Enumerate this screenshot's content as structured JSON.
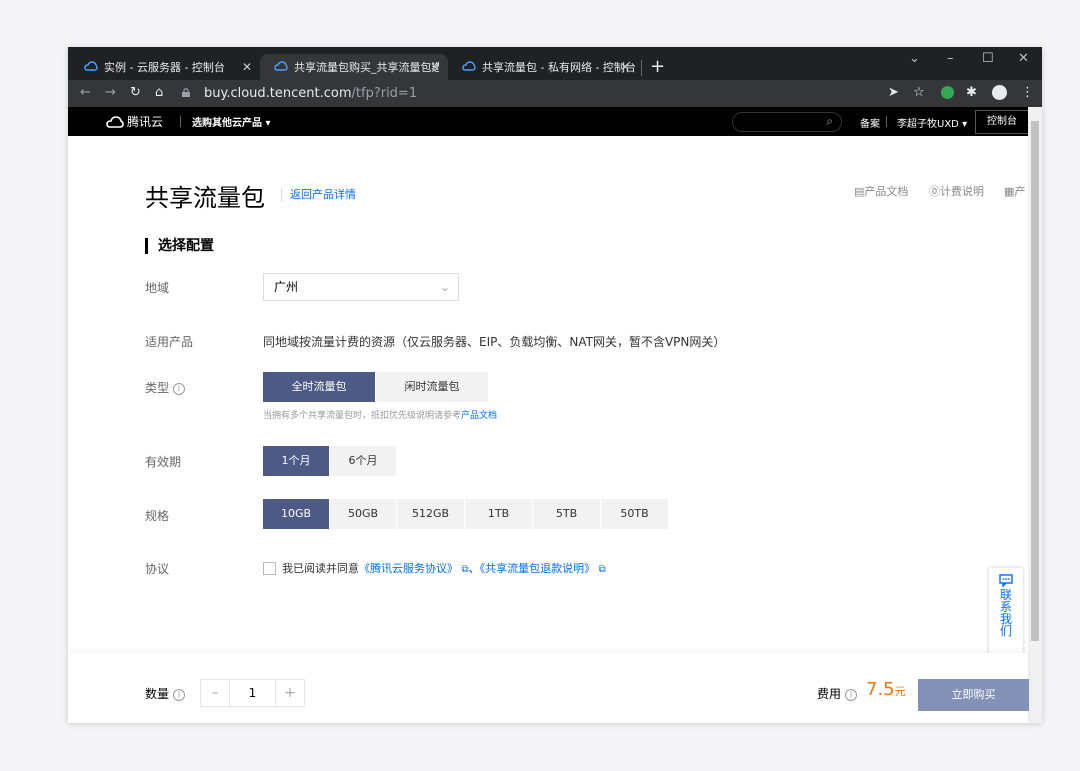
{
  "browser": {
    "tabs": [
      {
        "title": "实例 - 云服务器 - 控制台"
      },
      {
        "title": "共享流量包购买_共享流量包选购"
      },
      {
        "title": "共享流量包 - 私有网络 - 控制台"
      }
    ],
    "url_host": "buy.cloud.tencent.com",
    "url_path": "/tfp?rid=1"
  },
  "site": {
    "logo_text": "腾讯云",
    "other_products": "选购其他云产品",
    "beian": "备案",
    "user": "李超子牧UXD",
    "console": "控制台"
  },
  "page": {
    "title": "共享流量包",
    "back_link": "返回产品详情",
    "links": {
      "doc": "产品文档",
      "billing": "计费说明",
      "more": "产"
    },
    "section_title": "选择配置",
    "region": {
      "label": "地域",
      "value": "广州"
    },
    "products": {
      "label": "适用产品",
      "text": "同地域按流量计费的资源（仅云服务器、EIP、负载均衡、NAT网关，暂不含VPN网关）"
    },
    "type": {
      "label": "类型",
      "options": [
        "全时流量包",
        "闲时流量包"
      ],
      "selected": 0,
      "hint_prefix": "当拥有多个共享流量包时，抵扣优先级说明请参考",
      "hint_link": "产品文档"
    },
    "period": {
      "label": "有效期",
      "options": [
        "1个月",
        "6个月"
      ],
      "selected": 0
    },
    "spec": {
      "label": "规格",
      "options": [
        "10GB",
        "50GB",
        "512GB",
        "1TB",
        "5TB",
        "50TB"
      ],
      "selected": 0
    },
    "agreement": {
      "label": "协议",
      "prefix": "我已阅读并同意",
      "link1": "《腾讯云服务协议》",
      "sep": "、",
      "link2": "《共享流量包退款说明》"
    },
    "contact": [
      "联",
      "系",
      "我",
      "们"
    ]
  },
  "footer": {
    "qty_label": "数量",
    "qty_value": "1",
    "fee_label": "费用",
    "price": "7.5",
    "price_unit": "元",
    "buy_label": "立即购买"
  },
  "colors": {
    "accent": "#4d5a85",
    "link": "#006eff",
    "price": "#ff7200",
    "buy": "#8291b5"
  }
}
